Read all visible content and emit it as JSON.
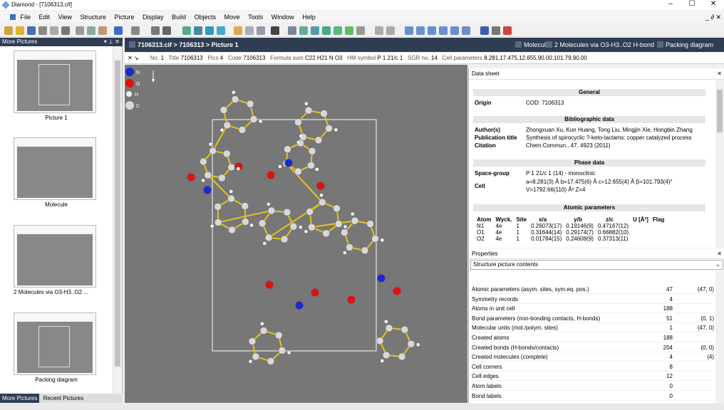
{
  "window": {
    "title": "Diamond - [7106313.cif]",
    "min": "–",
    "max": "☐",
    "close": "✕"
  },
  "menu": [
    "File",
    "Edit",
    "View",
    "Structure",
    "Picture",
    "Display",
    "Build",
    "Objects",
    "Move",
    "Tools",
    "Window",
    "Help"
  ],
  "menu_mdi": "_ ∂ ✕",
  "left_panel": {
    "title": "More Pictures",
    "controls": "▾ ⊥ ✕",
    "thumbs": [
      {
        "label": "Picture 1"
      },
      {
        "label": "Molecule"
      },
      {
        "label": "2 Molecules via O3-H3..O2 ..."
      },
      {
        "label": "Packing diagram"
      }
    ],
    "tabs": [
      "More Pictures",
      "Recent Pictures"
    ]
  },
  "doc_tabs": {
    "active": "7106313.cif > 7106313 > Picture 1",
    "others": [
      "Molecule",
      "2 Molecules via O3-H3..O2 H-bond",
      "Packing diagram"
    ]
  },
  "info": {
    "no_label": "No.",
    "no": "1",
    "title_label": "Title",
    "title": "7106313",
    "pics_label": "Pics",
    "pics": "4",
    "code_label": "Code",
    "code": "7106313",
    "formula_label": "Formula sum",
    "formula": "C22 H21 N O3",
    "hm_label": "HM symbol",
    "hm": "P 1 21/c 1",
    "sgr_label": "SGR no.",
    "sgr": "14",
    "cell_label": "Cell parameters",
    "cell": "8.281,17.475,12.655,90.00,101.79,90.00"
  },
  "legend": [
    "N",
    "O",
    "H",
    "C"
  ],
  "datasheet": {
    "title": "Data sheet",
    "general": "General",
    "origin_label": "Origin",
    "origin": "COD: 7106313",
    "biblio": "Bibliographic data",
    "authors_label": "Author(s)",
    "authors": "Zhongxuan Xu, Kun Huang, Tong Liu, Mingjin Xie, Hongbin Zhang",
    "pubtitle_label": "Publication title",
    "pubtitle": "Synthesis of spirocyclic ?-keto-lactams: copper catalyzed process",
    "citation_label": "Citation",
    "citation": "Chem.Commun., 47, 4923 (2011)",
    "phase": "Phase data",
    "sg_label": "Space-group",
    "sg": "P 1 21/c 1 (14) - monoclinic",
    "cell_label": "Cell",
    "cell1": "a=8.281(3) Å b=17.475(6) Å c=12.655(4) Å β=101.793(4)°",
    "cell2": "V=1792.66(110) Å³ Z=4",
    "atomic": "Atomic parameters",
    "atom_headers": [
      "Atom",
      "Wyck.",
      "Site",
      "x/a",
      "y/b",
      "z/c",
      "U [Å²]",
      "Flag"
    ],
    "atoms": [
      [
        "N1",
        "4e",
        "1",
        "0.26073(17)",
        "0.19146(9)",
        "0.47167(12)",
        "",
        ""
      ],
      [
        "O1",
        "4e",
        "1",
        "0.31644(14)",
        "0.29174(7)",
        "0.66882(10)",
        "",
        ""
      ],
      [
        "O2",
        "4e",
        "1",
        "0.01784(15)",
        "0.24608(9)",
        "0.37313(11)",
        "",
        ""
      ]
    ]
  },
  "properties": {
    "title": "Properties",
    "select": "Structure picture contents",
    "rows": [
      [
        "Atomic parameters (asym. sites, sym.eq. pos.)",
        "47",
        "(47, 0)"
      ],
      [
        "Symmetry records",
        "4",
        ""
      ],
      [
        "Atoms in unit cell",
        "188",
        ""
      ],
      [
        "Bond parameters (non-bonding contacts, H-bonds)",
        "51",
        "(0, 1)"
      ],
      [
        "Molecular units (mol./polym. sites)",
        "1",
        "(47, 0)"
      ],
      [
        "Created atoms",
        "188",
        ""
      ],
      [
        "Created bonds (H-bonds/contacts)",
        "204",
        "(0, 0)"
      ],
      [
        "Created molecules (complete)",
        "4",
        "(4)"
      ],
      [
        "Cell corners",
        "8",
        ""
      ],
      [
        "Cell edges",
        "12",
        ""
      ],
      [
        "Atom labels",
        "0",
        ""
      ],
      [
        "Bond labels",
        "0",
        ""
      ]
    ]
  },
  "colors": {
    "dark": "#2f3d52",
    "bond": "#e8c31a",
    "carbon": "#d8d8d8",
    "oxygen": "#e01010",
    "nitrogen": "#1a2ad0"
  }
}
